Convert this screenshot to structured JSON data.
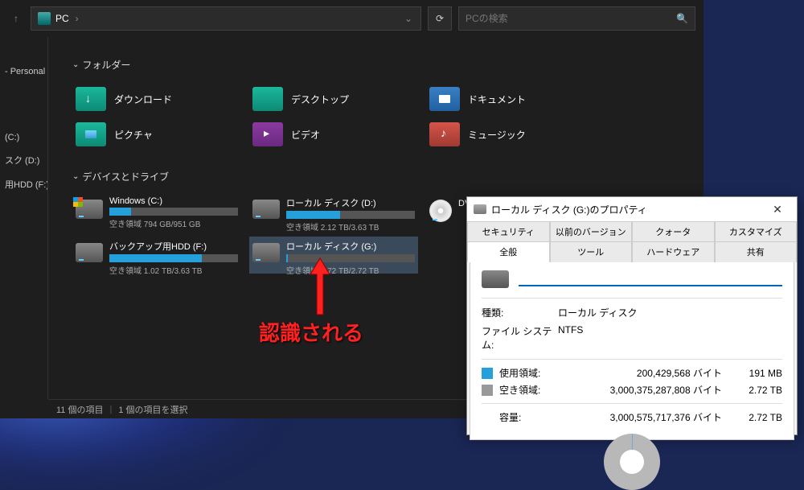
{
  "addr": {
    "location": "PC",
    "search_placeholder": "PCの検索"
  },
  "sidebar": {
    "items": [
      {
        "label": "- Personal"
      },
      {
        "label": "(C:)"
      },
      {
        "label": "スク (D:)"
      },
      {
        "label": "用HDD (F:)"
      }
    ]
  },
  "sections": {
    "folders": "フォルダー",
    "devices": "デバイスとドライブ"
  },
  "folders": [
    {
      "label": "ダウンロード",
      "icon": "download"
    },
    {
      "label": "デスクトップ",
      "icon": "desktop"
    },
    {
      "label": "ドキュメント",
      "icon": "docs"
    },
    {
      "label": "ピクチャ",
      "icon": "picture"
    },
    {
      "label": "ビデオ",
      "icon": "video"
    },
    {
      "label": "ミュージック",
      "icon": "music"
    }
  ],
  "drives": [
    {
      "name": "Windows (C:)",
      "space": "空き領域 794 GB/951 GB",
      "fill": 17,
      "icon": "win"
    },
    {
      "name": "ローカル ディスク (D:)",
      "space": "空き領域 2.12 TB/3.63 TB",
      "fill": 42,
      "icon": "hdd"
    },
    {
      "name": "DVD RW ドライブ (E:)",
      "space": "",
      "fill": -1,
      "icon": "dvd"
    },
    {
      "name": "バックアップ用HDD (F:)",
      "space": "空き領域 1.02 TB/3.63 TB",
      "fill": 72,
      "icon": "hdd"
    },
    {
      "name": "ローカル ディスク (G:)",
      "space": "空き領域 2.72 TB/2.72 TB",
      "fill": 1,
      "icon": "hdd",
      "selected": true
    }
  ],
  "status": {
    "count": "11 個の項目",
    "selected": "1 個の項目を選択"
  },
  "annotation": "認識される",
  "props": {
    "title": "ローカル ディスク (G:)のプロパティ",
    "tabs_row1": [
      "セキュリティ",
      "以前のバージョン",
      "クォータ",
      "カスタマイズ"
    ],
    "tabs_row2": [
      "全般",
      "ツール",
      "ハードウェア",
      "共有"
    ],
    "active_tab": "全般",
    "type_label": "種類:",
    "type_value": "ローカル ディスク",
    "fs_label": "ファイル システム:",
    "fs_value": "NTFS",
    "used_label": "使用領域:",
    "used_bytes": "200,429,568 バイト",
    "used_h": "191 MB",
    "free_label": "空き領域:",
    "free_bytes": "3,000,375,287,808 バイト",
    "free_h": "2.72 TB",
    "cap_label": "容量:",
    "cap_bytes": "3,000,575,717,376 バイト",
    "cap_h": "2.72 TB"
  }
}
